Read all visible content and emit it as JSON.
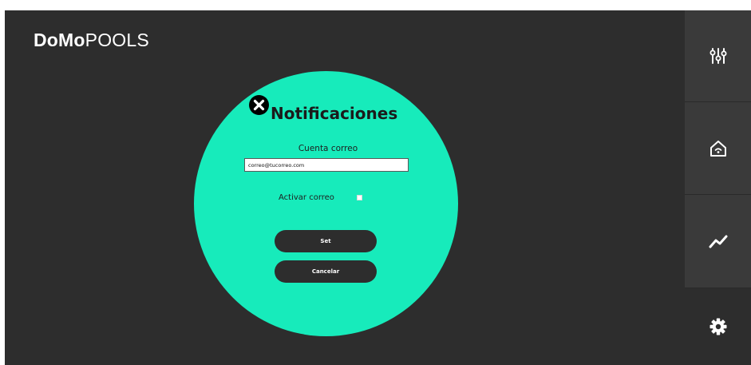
{
  "app": {
    "logo_bold": "DoMo",
    "logo_thin": "POOLS"
  },
  "sidebar": {
    "items": [
      {
        "icon": "sliders-icon"
      },
      {
        "icon": "smart-home-icon"
      },
      {
        "icon": "trend-chart-icon"
      },
      {
        "icon": "gear-icon"
      }
    ]
  },
  "dialog": {
    "title": "Notificaciones",
    "email_label": "Cuenta correo",
    "email_value": "correo@tucorreo.com",
    "activate_label": "Activar correo",
    "set_label": "Set",
    "cancel_label": "Cancelar"
  },
  "colors": {
    "background": "#2d2d2d",
    "rail": "#3a3a3a",
    "accent": "#17ebbb",
    "button": "#2d2d2d",
    "text_light": "#ffffff"
  }
}
